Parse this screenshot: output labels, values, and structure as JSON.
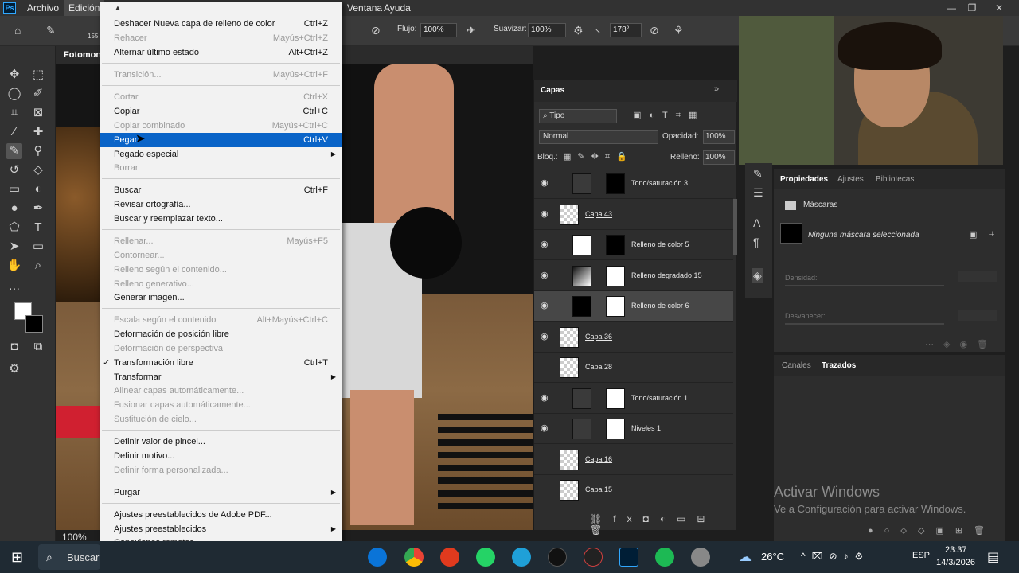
{
  "menubar": {
    "app_icon": "Ps",
    "items": [
      "Archivo",
      "Edición",
      "Ventana",
      "Ayuda"
    ],
    "window_controls": [
      "—",
      "❐",
      "✕"
    ]
  },
  "options": {
    "flujo_label": "Flujo:",
    "flujo_value": "100%",
    "suavizar_label": "Suavizar:",
    "suavizar_value": "100%",
    "angle_value": "178°",
    "brush_size": "155"
  },
  "document_tab": "Fotomon",
  "zoom": "100%",
  "edit_menu": {
    "items": [
      {
        "label": "Deshacer Nueva capa de relleno de color",
        "shortcut": "Ctrl+Z",
        "disabled": false
      },
      {
        "label": "Rehacer",
        "shortcut": "Mayús+Ctrl+Z",
        "disabled": true
      },
      {
        "label": "Alternar último estado",
        "shortcut": "Alt+Ctrl+Z",
        "disabled": false
      },
      {
        "label": "Transición...",
        "shortcut": "Mayús+Ctrl+F",
        "disabled": true
      },
      {
        "label": "Cortar",
        "shortcut": "Ctrl+X",
        "disabled": true
      },
      {
        "label": "Copiar",
        "shortcut": "Ctrl+C",
        "disabled": false
      },
      {
        "label": "Copiar combinado",
        "shortcut": "Mayús+Ctrl+C",
        "disabled": true
      },
      {
        "label": "Pegar",
        "shortcut": "Ctrl+V",
        "disabled": false,
        "selected": true
      },
      {
        "label": "Pegado especial",
        "shortcut": "",
        "disabled": false,
        "submenu": true
      },
      {
        "label": "Borrar",
        "shortcut": "",
        "disabled": true
      },
      {
        "label": "Buscar",
        "shortcut": "Ctrl+F",
        "disabled": false
      },
      {
        "label": "Revisar ortografía...",
        "shortcut": "",
        "disabled": false
      },
      {
        "label": "Buscar y reemplazar texto...",
        "shortcut": "",
        "disabled": false
      },
      {
        "label": "Rellenar...",
        "shortcut": "Mayús+F5",
        "disabled": true
      },
      {
        "label": "Contornear...",
        "shortcut": "",
        "disabled": true
      },
      {
        "label": "Relleno según el contenido...",
        "shortcut": "",
        "disabled": true
      },
      {
        "label": "Relleno generativo...",
        "shortcut": "",
        "disabled": true
      },
      {
        "label": "Generar imagen...",
        "shortcut": "",
        "disabled": false
      },
      {
        "label": "Escala según el contenido",
        "shortcut": "Alt+Mayús+Ctrl+C",
        "disabled": true
      },
      {
        "label": "Deformación de posición libre",
        "shortcut": "",
        "disabled": false
      },
      {
        "label": "Deformación de perspectiva",
        "shortcut": "",
        "disabled": true
      },
      {
        "label": "Transformación libre",
        "shortcut": "Ctrl+T",
        "disabled": false,
        "checked": true
      },
      {
        "label": "Transformar",
        "shortcut": "",
        "disabled": false,
        "submenu": true
      },
      {
        "label": "Alinear capas automáticamente...",
        "shortcut": "",
        "disabled": true
      },
      {
        "label": "Fusionar capas automáticamente...",
        "shortcut": "",
        "disabled": true
      },
      {
        "label": "Sustitución de cielo...",
        "shortcut": "",
        "disabled": true
      },
      {
        "label": "Definir valor de pincel...",
        "shortcut": "",
        "disabled": false
      },
      {
        "label": "Definir motivo...",
        "shortcut": "",
        "disabled": false
      },
      {
        "label": "Definir forma personalizada...",
        "shortcut": "",
        "disabled": true
      },
      {
        "label": "Purgar",
        "shortcut": "",
        "disabled": false,
        "submenu": true
      },
      {
        "label": "Ajustes preestablecidos de Adobe PDF...",
        "shortcut": "",
        "disabled": false
      },
      {
        "label": "Ajustes preestablecidos",
        "shortcut": "",
        "disabled": false,
        "submenu": true
      },
      {
        "label": "Conexiones remotas...",
        "shortcut": "",
        "disabled": false
      }
    ]
  },
  "layers_panel": {
    "title": "Capas",
    "filter": "Tipo",
    "blend_mode": "Normal",
    "opacity_label": "Opacidad:",
    "opacity_value": "100%",
    "lock_label": "Bloq.:",
    "fill_label": "Relleno:",
    "fill_value": "100%",
    "layers": [
      {
        "name": "Tono/saturación 3",
        "visible": true,
        "underline": false
      },
      {
        "name": "Capa 43",
        "visible": true,
        "underline": true
      },
      {
        "name": "Relleno de color 5",
        "visible": true,
        "underline": false
      },
      {
        "name": "Relleno degradado 15",
        "visible": true,
        "underline": false
      },
      {
        "name": "Relleno de color 6",
        "visible": true,
        "underline": false,
        "selected": true
      },
      {
        "name": "Capa 36",
        "visible": true,
        "underline": true
      },
      {
        "name": "Capa 28",
        "visible": false,
        "underline": false
      },
      {
        "name": "Tono/saturación 1",
        "visible": true,
        "underline": false
      },
      {
        "name": "Niveles 1",
        "visible": true,
        "underline": false
      },
      {
        "name": "Capa 16",
        "visible": false,
        "underline": true
      },
      {
        "name": "Capa 15",
        "visible": false,
        "underline": false
      }
    ]
  },
  "properties_panel": {
    "tabs": [
      "Propiedades",
      "Ajustes",
      "Bibliotecas"
    ],
    "section": "Máscaras",
    "mask_text": "Ninguna máscara seleccionada",
    "density_label": "Densidad:",
    "feather_label": "Desvanecer:"
  },
  "paths_panel": {
    "tabs": [
      "Canales",
      "Trazados"
    ]
  },
  "watermark": {
    "title": "Activar Windows",
    "subtitle": "Ve a Configuración para activar Windows."
  },
  "taskbar": {
    "search_label": "Buscar",
    "temperature": "26°C",
    "language": "ESP",
    "time": "23:37",
    "date": "14/3/2026"
  }
}
